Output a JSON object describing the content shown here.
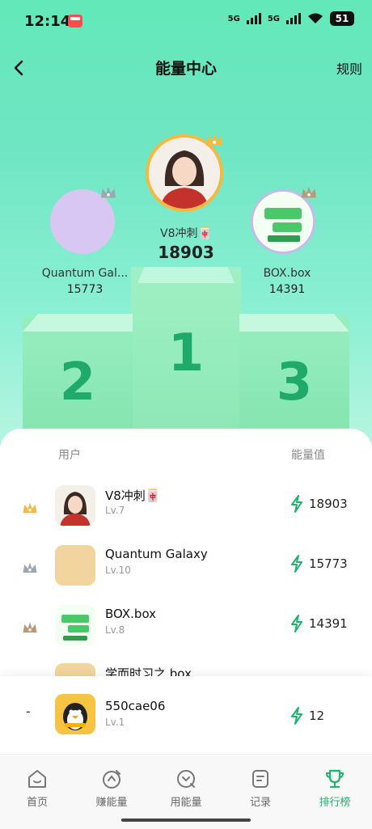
{
  "status_bar": {
    "time": "12:14",
    "sim1": "5G",
    "sim2": "5G",
    "battery": "51"
  },
  "header": {
    "title": "能量中心",
    "rules_label": "规则"
  },
  "podium": {
    "first": {
      "name": "V8冲刺🀄",
      "score": "18903",
      "rank_label": "1"
    },
    "second": {
      "name": "Quantum Gal...",
      "score": "15773",
      "rank_label": "2"
    },
    "third": {
      "name": "BOX.box",
      "score": "14391",
      "rank_label": "3"
    }
  },
  "leaderboard": {
    "col_user": "用户",
    "col_energy": "能量值",
    "rows": [
      {
        "name": "V8冲刺🀄",
        "level": "Lv.7",
        "score": "18903"
      },
      {
        "name": "Quantum Galaxy",
        "level": "Lv.10",
        "score": "15773"
      },
      {
        "name": "BOX.box",
        "level": "Lv.8",
        "score": "14391"
      },
      {
        "name": "学而时习之.box",
        "level": "",
        "score": ""
      }
    ]
  },
  "my_rank": {
    "rank": "-",
    "name": "550cae06",
    "level": "Lv.1",
    "score": "12"
  },
  "bottom_nav": {
    "items": [
      {
        "label": "首页",
        "icon": "home-icon"
      },
      {
        "label": "赚能量",
        "icon": "earn-energy-icon"
      },
      {
        "label": "用能量",
        "icon": "use-energy-icon"
      },
      {
        "label": "记录",
        "icon": "record-icon"
      },
      {
        "label": "排行榜",
        "icon": "trophy-icon"
      }
    ],
    "active_index": 4
  },
  "colors": {
    "accent": "#1fb36f",
    "gold": "#f5b940",
    "silver": "#9aa6b2",
    "bronze": "#b89a7a"
  }
}
